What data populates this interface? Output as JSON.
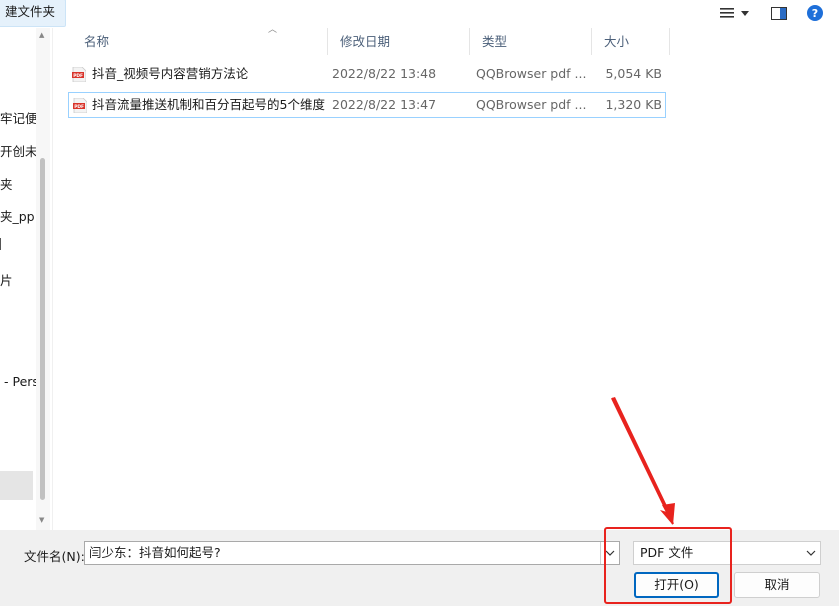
{
  "toolbar": {
    "new_folder_label": "建文件夹",
    "view_icon": "view-list-icon",
    "preview_icon": "preview-pane-icon",
    "help_icon": "help-icon"
  },
  "nav": {
    "items": [
      "牢记便",
      "开创未",
      "夹",
      "夹_pp",
      "",
      "片",
      "- Pers"
    ]
  },
  "columns": {
    "name": "名称",
    "date": "修改日期",
    "type": "类型",
    "size": "大小"
  },
  "files": [
    {
      "name": "抖音_视频号内容营销方法论",
      "date": "2022/8/22 13:48",
      "type": "QQBrowser pdf ...",
      "size": "5,054 KB"
    },
    {
      "name": "抖音流量推送机制和百分百起号的5个维度",
      "date": "2022/8/22 13:47",
      "type": "QQBrowser pdf ...",
      "size": "1,320 KB"
    }
  ],
  "footer": {
    "filename_label": "文件名(N):",
    "filename_value": "闫少东：抖音如何起号?",
    "filetype_value": "PDF 文件",
    "open_label": "打开(O)",
    "cancel_label": "取消"
  },
  "colors": {
    "accent": "#0067c0",
    "selection_border": "#99d1ff",
    "annotation_red": "#e8231e",
    "pdf_red": "#d9342b"
  }
}
